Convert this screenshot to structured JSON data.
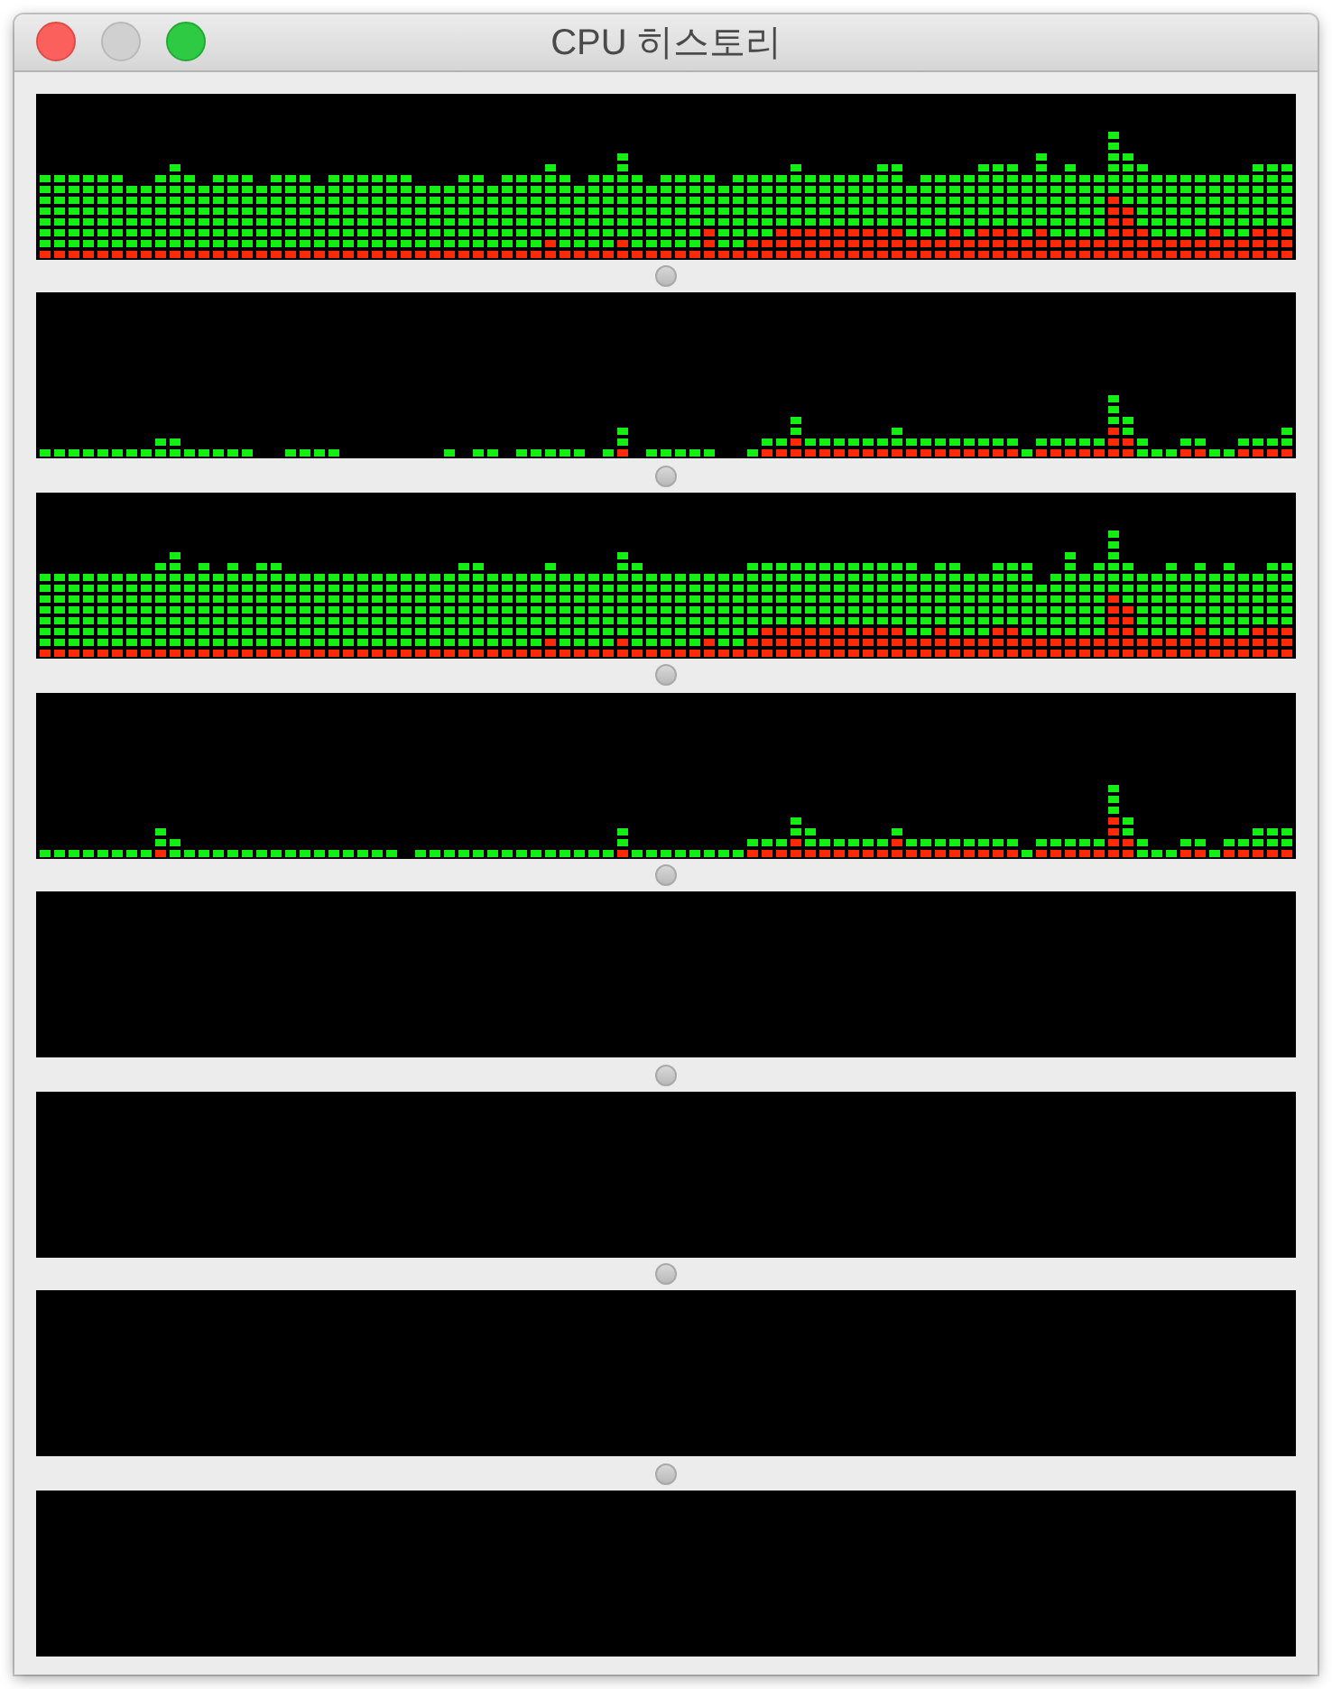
{
  "window": {
    "title": "CPU 히스토리",
    "buttons": [
      {
        "kind": "close",
        "disabled": false
      },
      {
        "kind": "minimize",
        "disabled": true
      },
      {
        "kind": "zoom",
        "disabled": false
      }
    ]
  }
}
